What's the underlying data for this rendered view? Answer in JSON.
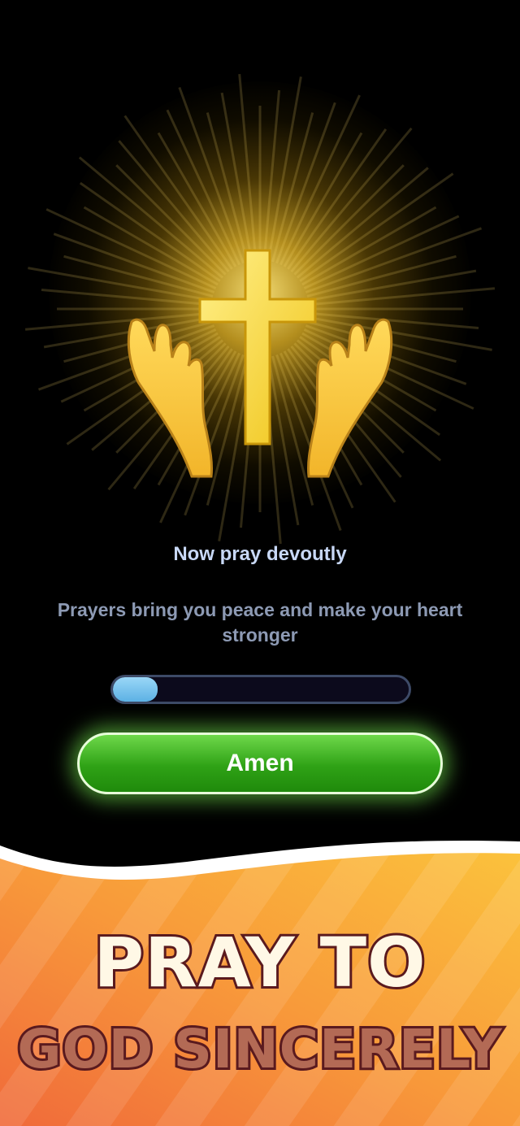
{
  "prayer": {
    "title": "Now pray devoutly",
    "subtitle": "Prayers bring you peace and make your heart stronger",
    "progress": 0.15,
    "button_label": "Amen"
  },
  "banner": {
    "line1": "PRAY TO",
    "line2": "GOD SINCERELY"
  },
  "icons": {
    "hero": "cross-with-hands-icon"
  },
  "colors": {
    "background": "#000000",
    "button_green": "#2fa216",
    "progress_blue": "#5cb1e4",
    "banner_orange": "#f7a23a"
  }
}
